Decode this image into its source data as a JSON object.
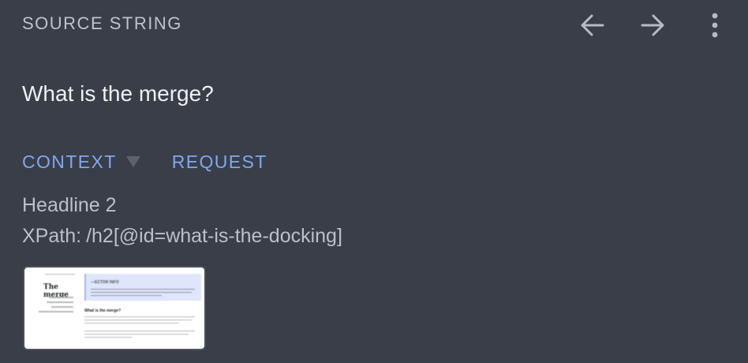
{
  "header": {
    "label": "SOURCE STRING",
    "back_icon": "arrow-left-icon",
    "forward_icon": "arrow-right-icon",
    "more_icon": "more-vertical-icon"
  },
  "source": {
    "text": "What is the merge?"
  },
  "tabs": {
    "context_label": "CONTEXT",
    "request_label": "REQUEST"
  },
  "context": {
    "element_type": "Headline 2",
    "xpath_label": "XPath:",
    "xpath_value": "/h2[@id=what-is-the-docking]"
  },
  "screenshot_thumb": {
    "page_title": "The merge",
    "callout_heading": "—ECTOR INFO",
    "section_heading": "What is the merge?"
  },
  "colors": {
    "background": "#393e48",
    "accent": "#7fa8f0",
    "muted_text": "#bcc0c6"
  }
}
